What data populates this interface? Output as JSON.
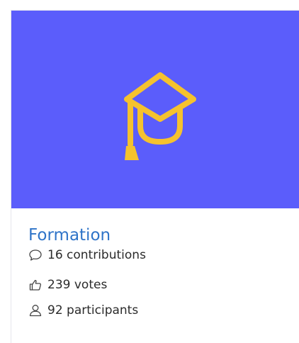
{
  "card": {
    "title": "Formation",
    "hero_color": "#5b5dfb",
    "icon": "graduation-cap-icon",
    "icon_color": "#f5c22e",
    "stats": {
      "contributions": {
        "icon": "speech-bubble-icon",
        "label": "16 contributions"
      },
      "votes": {
        "icon": "thumbs-up-icon",
        "label": "239 votes"
      },
      "participants": {
        "icon": "user-icon",
        "label": "92 participants"
      }
    }
  }
}
